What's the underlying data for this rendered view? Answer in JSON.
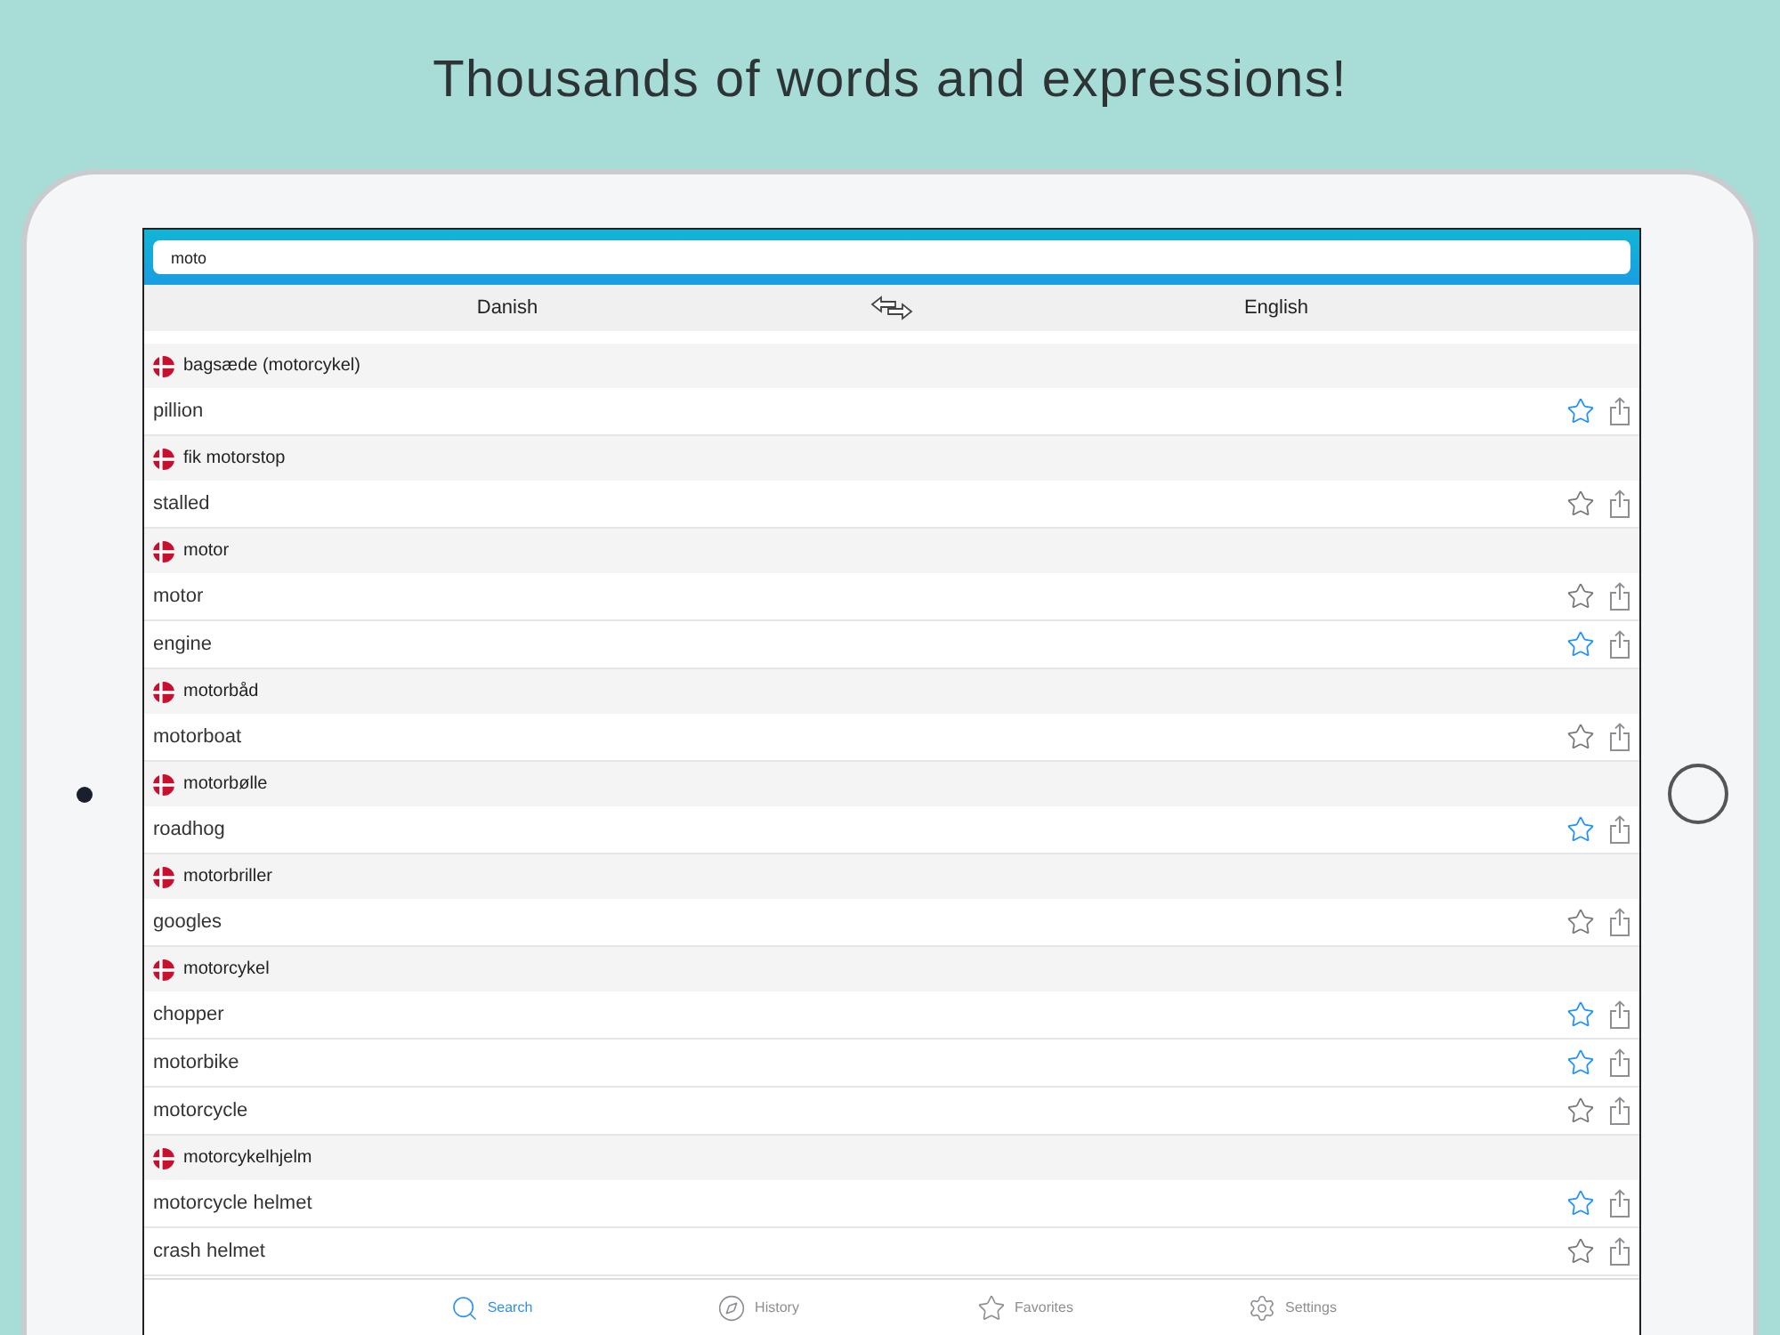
{
  "headline": "Thousands of words and expressions!",
  "search": {
    "value": "moto"
  },
  "languages": {
    "source": "Danish",
    "target": "English"
  },
  "entries": [
    {
      "word": "bagsæde (motorcykel)",
      "translations": [
        {
          "text": "pillion",
          "favorite": true
        }
      ]
    },
    {
      "word": "fik motorstop",
      "translations": [
        {
          "text": "stalled",
          "favorite": false
        }
      ]
    },
    {
      "word": "motor",
      "translations": [
        {
          "text": "motor",
          "favorite": false
        },
        {
          "text": "engine",
          "favorite": true
        }
      ]
    },
    {
      "word": "motorbåd",
      "translations": [
        {
          "text": "motorboat",
          "favorite": false
        }
      ]
    },
    {
      "word": "motorbølle",
      "translations": [
        {
          "text": "roadhog",
          "favorite": true
        }
      ]
    },
    {
      "word": "motorbriller",
      "translations": [
        {
          "text": "googles",
          "favorite": false
        }
      ]
    },
    {
      "word": "motorcykel",
      "translations": [
        {
          "text": "chopper",
          "favorite": true
        },
        {
          "text": "motorbike",
          "favorite": true
        },
        {
          "text": "motorcycle",
          "favorite": false
        }
      ]
    },
    {
      "word": "motorcykelhjelm",
      "translations": [
        {
          "text": "motorcycle helmet",
          "favorite": true
        },
        {
          "text": "crash helmet",
          "favorite": false
        }
      ]
    }
  ],
  "tabs": [
    {
      "kind": "search",
      "label": "Search",
      "selected": true
    },
    {
      "kind": "history",
      "label": "History",
      "selected": false
    },
    {
      "kind": "favorites",
      "label": "Favorites",
      "selected": false
    },
    {
      "kind": "settings",
      "label": "Settings",
      "selected": false
    }
  ]
}
